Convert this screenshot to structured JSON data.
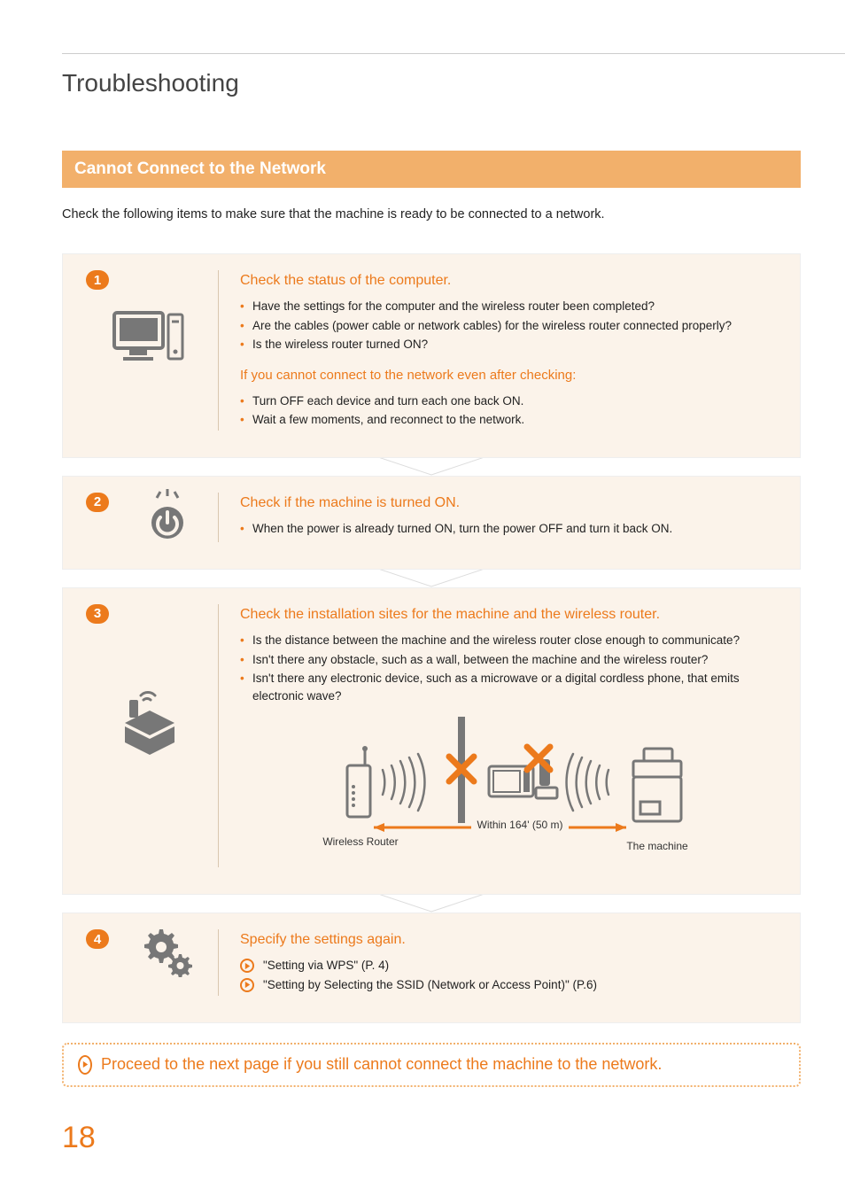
{
  "page": {
    "title": "Troubleshooting",
    "section_heading": "Cannot Connect to the Network",
    "intro": "Check the following items to make sure that the machine is ready to be connected to a network.",
    "notice": "Proceed to the next page if you still cannot connect the machine to the network.",
    "page_number": "18"
  },
  "steps": [
    {
      "num": "1",
      "heading": "Check the status of the computer.",
      "bullets": [
        "Have the settings for the computer and the wireless router been completed?",
        "Are the cables (power cable or network cables) for the wireless router connected properly?",
        "Is the wireless router turned ON?"
      ],
      "sub_heading": "If you cannot connect to the network even after checking:",
      "sub_bullets": [
        "Turn OFF each device and turn each one back ON.",
        "Wait a few moments, and reconnect to the network."
      ]
    },
    {
      "num": "2",
      "heading": "Check if the machine is turned ON.",
      "bullets": [
        "When the power is already turned ON, turn the power OFF and turn it back ON."
      ]
    },
    {
      "num": "3",
      "heading": "Check the installation sites for the machine and the wireless router.",
      "bullets": [
        "Is the distance between the machine and the wireless router close enough to communicate?",
        "Isn't there any obstacle, such as a wall, between the machine and the wireless router?",
        "Isn't there any electronic device, such as a microwave or a digital cordless phone, that emits electronic wave?"
      ],
      "diagram": {
        "router_label": "Wireless Router",
        "distance_label": "Within 164' (50 m)",
        "machine_label": "The machine"
      }
    },
    {
      "num": "4",
      "heading": "Specify the settings again.",
      "links": [
        "\"Setting via WPS\" (P. 4)",
        "\"Setting by Selecting the SSID (Network or Access Point)\" (P.6)"
      ]
    }
  ]
}
